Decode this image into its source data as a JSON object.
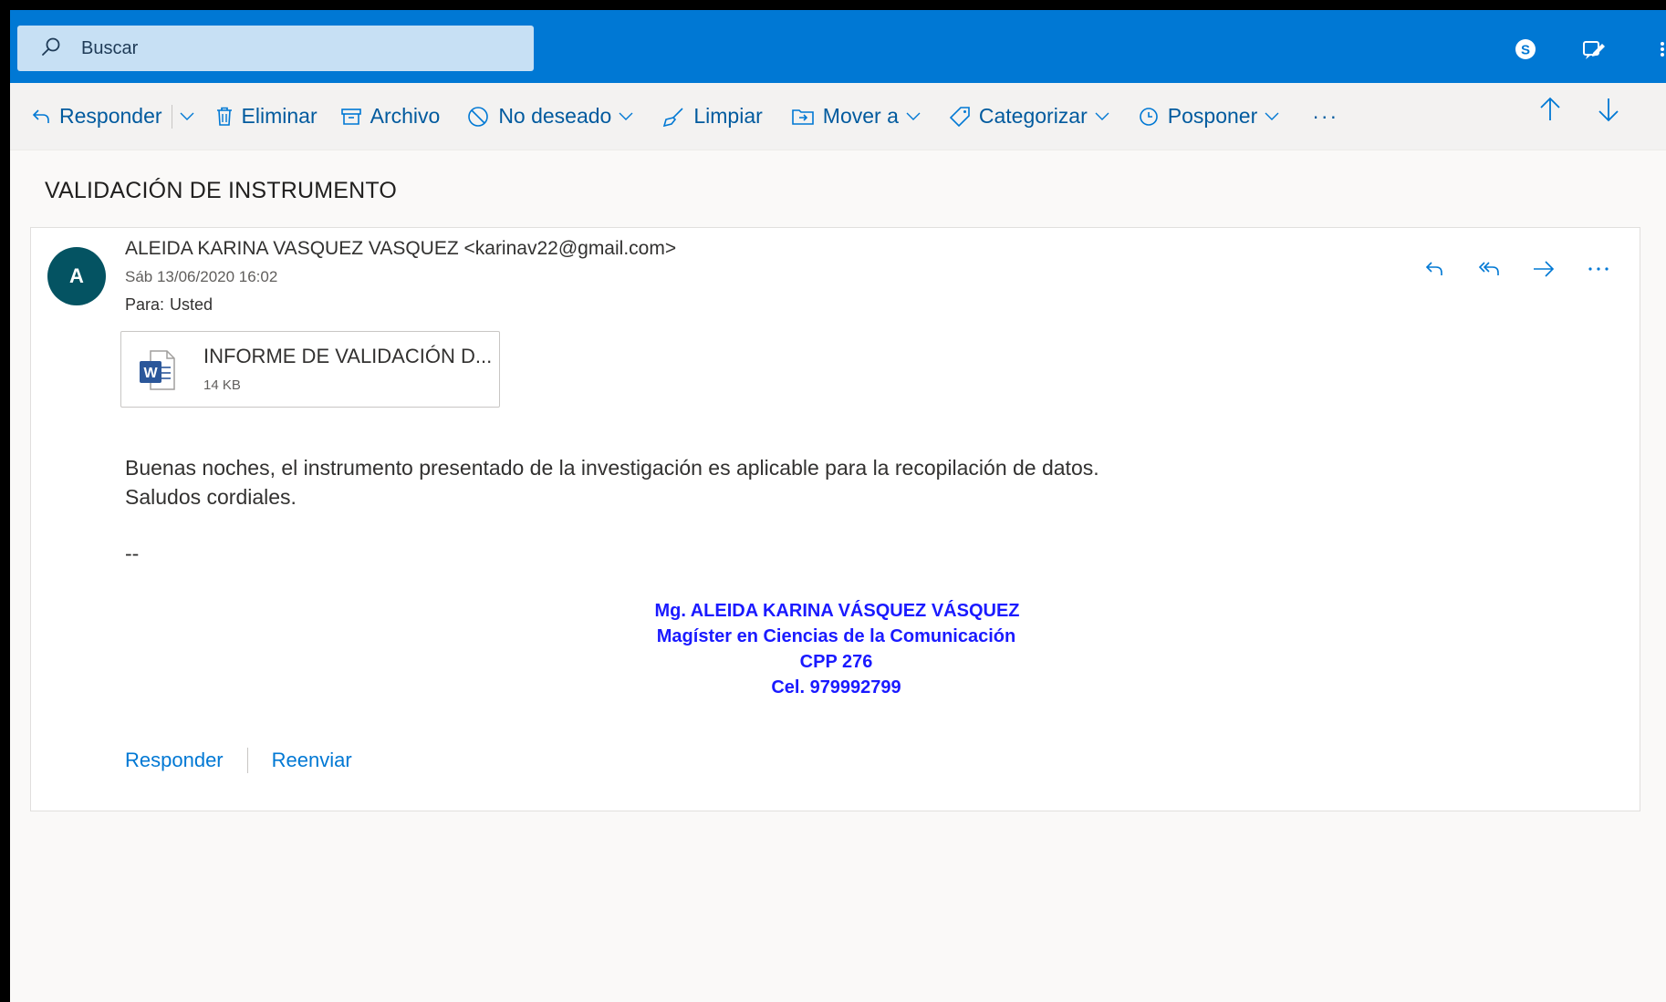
{
  "search": {
    "placeholder": "Buscar"
  },
  "topbar": {
    "icons": [
      "skype-icon",
      "feedback-icon"
    ]
  },
  "toolbar": {
    "reply": "Responder",
    "delete": "Eliminar",
    "archive": "Archivo",
    "junk": "No deseado",
    "sweep": "Limpiar",
    "move": "Mover a",
    "categorize": "Categorizar",
    "snooze": "Posponer",
    "more": "···"
  },
  "message": {
    "subject": "VALIDACIÓN DE INSTRUMENTO",
    "avatar_initial": "A",
    "sender": "ALEIDA KARINA VASQUEZ VASQUEZ <karinav22@gmail.com>",
    "date": "Sáb 13/06/2020 16:02",
    "to_label": "Para:",
    "to_value": "Usted",
    "attachment": {
      "name": "INFORME DE VALIDACIÓN D...",
      "size": "14 KB"
    },
    "body_line1": "Buenas noches, el instrumento presentado de la investigación es aplicable para la recopilación de datos.",
    "body_line2": "Saludos cordiales.",
    "separator": "--",
    "signature": {
      "line1": "Mg. ALEIDA KARINA VÁSQUEZ VÁSQUEZ",
      "line2": "Magíster en Ciencias de la Comunicación",
      "line3": "CPP 276",
      "line4": "Cel. 979992799"
    },
    "footer_reply": "Responder",
    "footer_forward": "Reenviar"
  },
  "colors": {
    "brand": "#0078d4",
    "avatar": "#045362",
    "signature": "#1a1aff"
  }
}
